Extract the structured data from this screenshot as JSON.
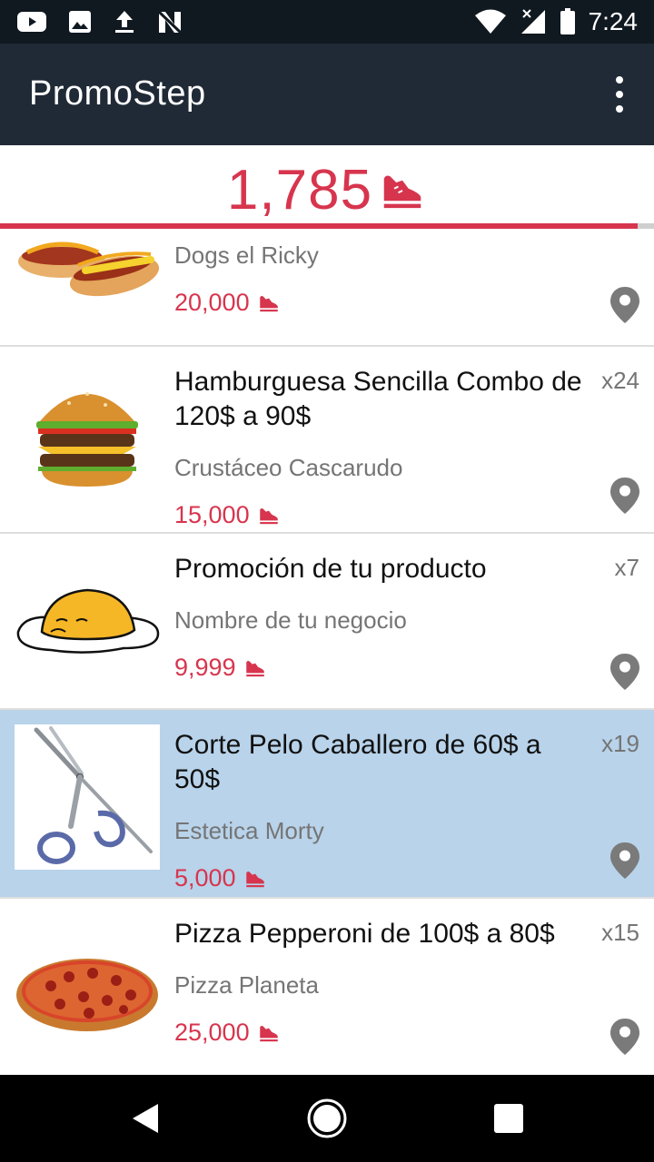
{
  "status_bar": {
    "time": "7:24",
    "left_icons": [
      "youtube-icon",
      "image-icon",
      "upload-icon",
      "n-icon"
    ],
    "right_icons": [
      "wifi-icon",
      "signal-icon",
      "battery-icon"
    ]
  },
  "app_bar": {
    "title": "PromoStep",
    "menu_icon": "more-vert-icon"
  },
  "steps": {
    "count": "1,785",
    "icon": "shoe-icon",
    "progress_fraction": 0.975
  },
  "colors": {
    "accent": "#d7354e",
    "appbar": "#202a36",
    "statusbar": "#101820",
    "selected_row": "#b8d3ea"
  },
  "promotions": [
    {
      "title": "",
      "business": "Dogs el Ricky",
      "price": "20,000",
      "qty": "",
      "image": "hotdog-image"
    },
    {
      "title": "Hamburguesa Sencilla Combo de 120$ a 90$",
      "business": "Crustáceo Cascarudo",
      "price": "15,000",
      "qty": "x24",
      "image": "burger-image"
    },
    {
      "title": "Promoción de tu producto",
      "business": "Nombre de tu negocio",
      "price": "9,999",
      "qty": "x7",
      "image": "egg-character-image"
    },
    {
      "title": "Corte Pelo Caballero de 60$ a 50$",
      "business": "Estetica Morty",
      "price": "5,000",
      "qty": "x19",
      "image": "scissors-image",
      "selected": true
    },
    {
      "title": "Pizza Pepperoni de 100$ a 80$",
      "business": "Pizza Planeta",
      "price": "25,000",
      "qty": "x15",
      "image": "pizza-image"
    }
  ],
  "nav_bar": {
    "buttons": [
      "back-icon",
      "home-icon",
      "recents-icon"
    ]
  }
}
